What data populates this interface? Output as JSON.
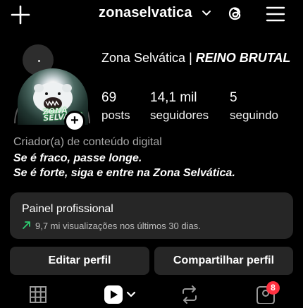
{
  "header": {
    "username": "zonaselvatica",
    "icons": [
      "plus-icon",
      "chevron-down-icon",
      "threads-icon",
      "menu-icon"
    ]
  },
  "profile": {
    "display_name_plain": "Zona Selvática | ",
    "display_name_emph": "REINO BRUTAL",
    "avatar_brand_line1": "ZONA",
    "avatar_brand_line2": "SELVATIC"
  },
  "stats": {
    "posts_value": "69",
    "posts_label": "posts",
    "followers_value": "14,1 mil",
    "followers_label": "seguidores",
    "following_value": "5",
    "following_label": "seguindo"
  },
  "bio": {
    "category": "Criador(a) de conteúdo digital",
    "line1": "Se é fraco, passe longe.",
    "line2": "Se é forte, siga e entre na Zona Selvática."
  },
  "dashboard": {
    "title": "Painel profissional",
    "subtitle": "9,7 mi visualizações nos últimos 30 dias.",
    "trend_color": "#2ecc71"
  },
  "buttons": {
    "edit": "Editar perfil",
    "share": "Compartilhar perfil"
  },
  "tabs": {
    "tagged_badge": "8",
    "badge_color": "#ff3040"
  }
}
